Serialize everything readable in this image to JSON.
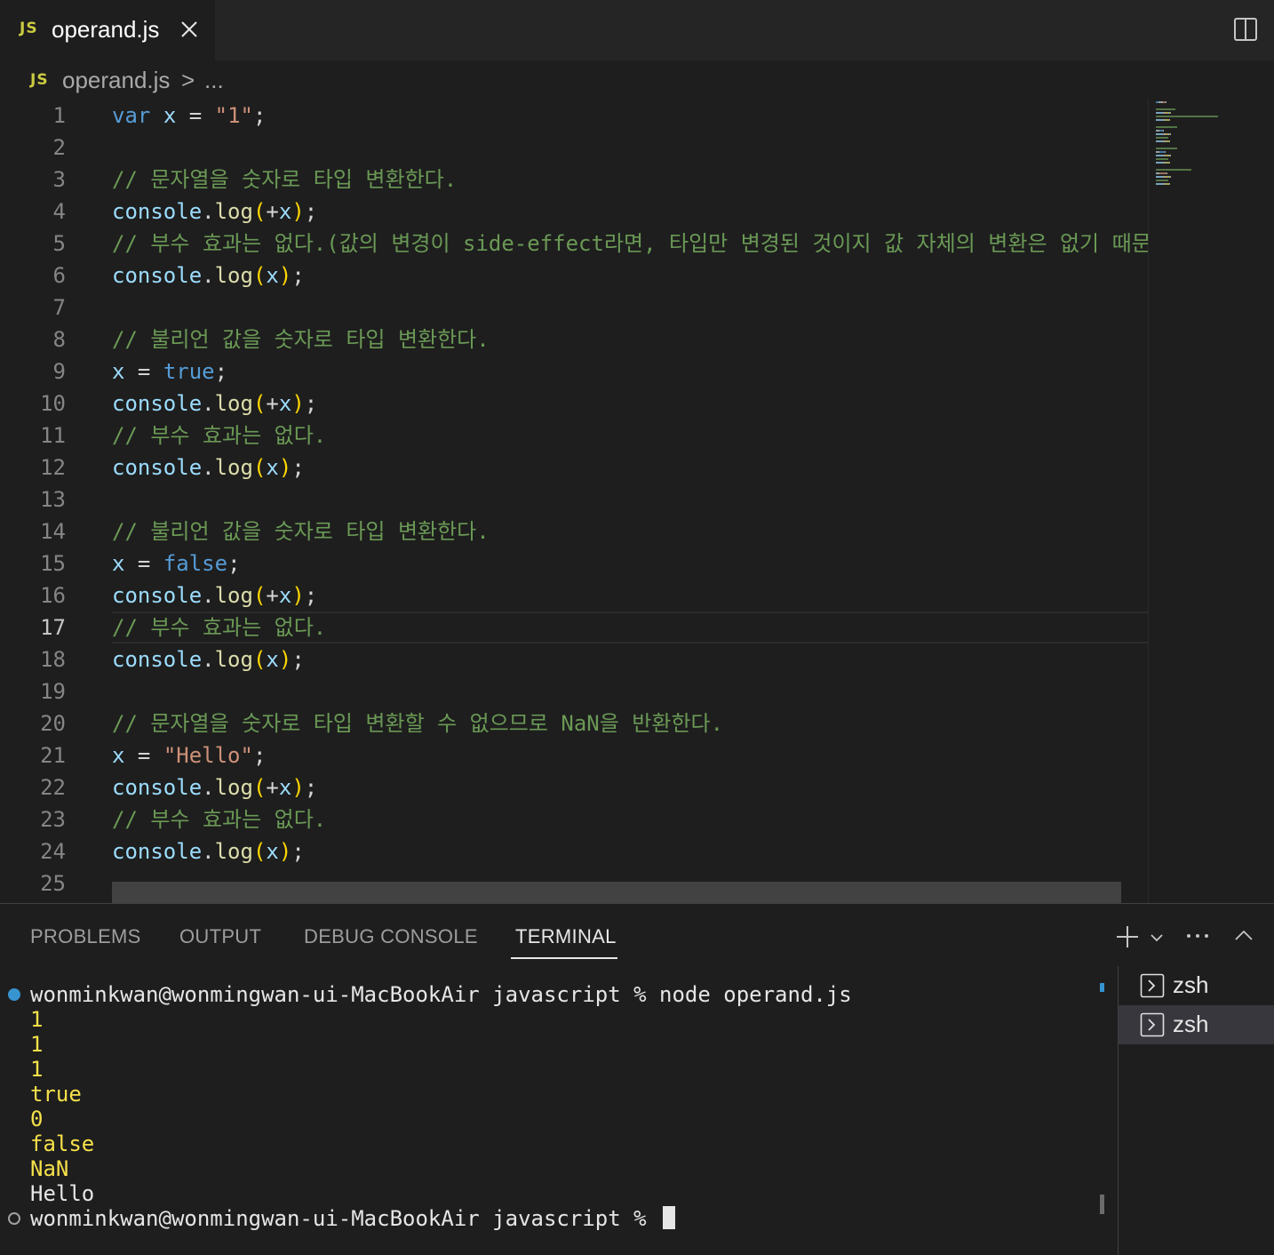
{
  "tab": {
    "badge": "JS",
    "title": "operand.js"
  },
  "breadcrumb": {
    "badge": "JS",
    "file": "operand.js",
    "separator": ">",
    "more": "..."
  },
  "editor": {
    "current_line": 17,
    "lines": [
      {
        "n": "1",
        "tokens": [
          [
            "k",
            "var"
          ],
          [
            "p",
            " "
          ],
          [
            "v",
            "x"
          ],
          [
            "p",
            " = "
          ],
          [
            "s",
            "\"1\""
          ],
          [
            "p",
            ";"
          ]
        ]
      },
      {
        "n": "2",
        "tokens": []
      },
      {
        "n": "3",
        "tokens": [
          [
            "c",
            "// 문자열을 숫자로 타입 변환한다."
          ]
        ]
      },
      {
        "n": "4",
        "tokens": [
          [
            "v",
            "console"
          ],
          [
            "p",
            "."
          ],
          [
            "f",
            "log"
          ],
          [
            "b",
            "("
          ],
          [
            "p",
            "+"
          ],
          [
            "v",
            "x"
          ],
          [
            "b",
            ")"
          ],
          [
            "p",
            ";"
          ]
        ]
      },
      {
        "n": "5",
        "tokens": [
          [
            "c",
            "// 부수 효과는 없다.(값의 변경이 side-effect라면, 타입만 변경된 것이지 값 자체의 변환은 없기 때문)"
          ]
        ]
      },
      {
        "n": "6",
        "tokens": [
          [
            "v",
            "console"
          ],
          [
            "p",
            "."
          ],
          [
            "f",
            "log"
          ],
          [
            "b",
            "("
          ],
          [
            "v",
            "x"
          ],
          [
            "b",
            ")"
          ],
          [
            "p",
            ";"
          ]
        ]
      },
      {
        "n": "7",
        "tokens": []
      },
      {
        "n": "8",
        "tokens": [
          [
            "c",
            "// 불리언 값을 숫자로 타입 변환한다."
          ]
        ]
      },
      {
        "n": "9",
        "tokens": [
          [
            "v",
            "x"
          ],
          [
            "p",
            " = "
          ],
          [
            "k",
            "true"
          ],
          [
            "p",
            ";"
          ]
        ]
      },
      {
        "n": "10",
        "tokens": [
          [
            "v",
            "console"
          ],
          [
            "p",
            "."
          ],
          [
            "f",
            "log"
          ],
          [
            "b",
            "("
          ],
          [
            "p",
            "+"
          ],
          [
            "v",
            "x"
          ],
          [
            "b",
            ")"
          ],
          [
            "p",
            ";"
          ]
        ]
      },
      {
        "n": "11",
        "tokens": [
          [
            "c",
            "// 부수 효과는 없다."
          ]
        ]
      },
      {
        "n": "12",
        "tokens": [
          [
            "v",
            "console"
          ],
          [
            "p",
            "."
          ],
          [
            "f",
            "log"
          ],
          [
            "b",
            "("
          ],
          [
            "v",
            "x"
          ],
          [
            "b",
            ")"
          ],
          [
            "p",
            ";"
          ]
        ]
      },
      {
        "n": "13",
        "tokens": []
      },
      {
        "n": "14",
        "tokens": [
          [
            "c",
            "// 불리언 값을 숫자로 타입 변환한다."
          ]
        ]
      },
      {
        "n": "15",
        "tokens": [
          [
            "v",
            "x"
          ],
          [
            "p",
            " = "
          ],
          [
            "k",
            "false"
          ],
          [
            "p",
            ";"
          ]
        ]
      },
      {
        "n": "16",
        "tokens": [
          [
            "v",
            "console"
          ],
          [
            "p",
            "."
          ],
          [
            "f",
            "log"
          ],
          [
            "b",
            "("
          ],
          [
            "p",
            "+"
          ],
          [
            "v",
            "x"
          ],
          [
            "b",
            ")"
          ],
          [
            "p",
            ";"
          ]
        ]
      },
      {
        "n": "17",
        "tokens": [
          [
            "c",
            "// 부수 효과는 없다."
          ]
        ]
      },
      {
        "n": "18",
        "tokens": [
          [
            "v",
            "console"
          ],
          [
            "p",
            "."
          ],
          [
            "f",
            "log"
          ],
          [
            "b",
            "("
          ],
          [
            "v",
            "x"
          ],
          [
            "b",
            ")"
          ],
          [
            "p",
            ";"
          ]
        ]
      },
      {
        "n": "19",
        "tokens": []
      },
      {
        "n": "20",
        "tokens": [
          [
            "c",
            "// 문자열을 숫자로 타입 변환할 수 없으므로 NaN을 반환한다."
          ]
        ]
      },
      {
        "n": "21",
        "tokens": [
          [
            "v",
            "x"
          ],
          [
            "p",
            " = "
          ],
          [
            "s",
            "\"Hello\""
          ],
          [
            "p",
            ";"
          ]
        ]
      },
      {
        "n": "22",
        "tokens": [
          [
            "v",
            "console"
          ],
          [
            "p",
            "."
          ],
          [
            "f",
            "log"
          ],
          [
            "b",
            "("
          ],
          [
            "p",
            "+"
          ],
          [
            "v",
            "x"
          ],
          [
            "b",
            ")"
          ],
          [
            "p",
            ";"
          ]
        ]
      },
      {
        "n": "23",
        "tokens": [
          [
            "c",
            "// 부수 효과는 없다."
          ]
        ]
      },
      {
        "n": "24",
        "tokens": [
          [
            "v",
            "console"
          ],
          [
            "p",
            "."
          ],
          [
            "f",
            "log"
          ],
          [
            "b",
            "("
          ],
          [
            "v",
            "x"
          ],
          [
            "b",
            ")"
          ],
          [
            "p",
            ";"
          ]
        ]
      },
      {
        "n": "25",
        "tokens": []
      }
    ]
  },
  "panel": {
    "tabs": [
      "PROBLEMS",
      "OUTPUT",
      "DEBUG CONSOLE",
      "TERMINAL"
    ],
    "active_tab": "TERMINAL"
  },
  "terminal": {
    "prompt_cmd": "wonminkwan@wonmingwan-ui-MacBookAir javascript % node operand.js",
    "output": [
      "1",
      "1",
      "1",
      "true",
      "0",
      "false",
      "NaN",
      "Hello"
    ],
    "prompt": "wonminkwan@wonmingwan-ui-MacBookAir javascript % ",
    "instances": [
      "zsh",
      "zsh"
    ],
    "selected_instance": 1
  },
  "colors": {
    "editor_bg": "#1e1e1e",
    "keyword": "#569cd6",
    "variable": "#9cdcfe",
    "function": "#dcdcaa",
    "string": "#ce9178",
    "comment": "#6a9955",
    "bracket": "#ffd700",
    "terminal_output": "#f5e04a"
  }
}
